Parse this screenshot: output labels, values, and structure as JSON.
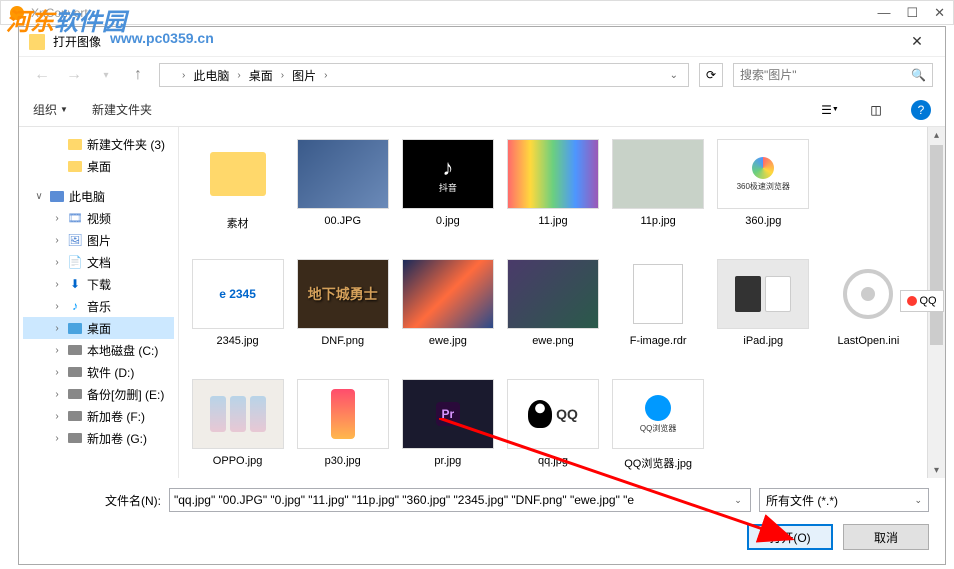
{
  "outerWindow": {
    "title": "XnConvert"
  },
  "watermark": {
    "line1a": "河东",
    "line1b": "软件园",
    "url": "www.pc0359.cn"
  },
  "dialog": {
    "title": "打开图像",
    "breadcrumb": [
      "此电脑",
      "桌面",
      "图片"
    ],
    "searchPlaceholder": "搜索\"图片\"",
    "organize": "组织",
    "newFolder": "新建文件夹"
  },
  "tree": {
    "items": [
      {
        "label": "新建文件夹 (3)",
        "indent": 28,
        "icon": "folder"
      },
      {
        "label": "桌面",
        "indent": 28,
        "icon": "folder"
      },
      {
        "label": "",
        "indent": 0,
        "icon": ""
      },
      {
        "label": "此电脑",
        "indent": 10,
        "icon": "pc",
        "twisty": "∨"
      },
      {
        "label": "视频",
        "indent": 28,
        "icon": "video",
        "twisty": "›"
      },
      {
        "label": "图片",
        "indent": 28,
        "icon": "pic",
        "twisty": "›"
      },
      {
        "label": "文档",
        "indent": 28,
        "icon": "doc",
        "twisty": "›"
      },
      {
        "label": "下载",
        "indent": 28,
        "icon": "down",
        "twisty": "›"
      },
      {
        "label": "音乐",
        "indent": 28,
        "icon": "music",
        "twisty": "›"
      },
      {
        "label": "桌面",
        "indent": 28,
        "icon": "desktop",
        "twisty": "›",
        "selected": true
      },
      {
        "label": "本地磁盘 (C:)",
        "indent": 28,
        "icon": "drive",
        "twisty": "›"
      },
      {
        "label": "软件 (D:)",
        "indent": 28,
        "icon": "drive",
        "twisty": "›"
      },
      {
        "label": "备份[勿删] (E:)",
        "indent": 28,
        "icon": "drive",
        "twisty": "›"
      },
      {
        "label": "新加卷 (F:)",
        "indent": 28,
        "icon": "drive",
        "twisty": "›"
      },
      {
        "label": "新加卷 (G:)",
        "indent": 28,
        "icon": "drive",
        "twisty": "›"
      }
    ]
  },
  "files": [
    {
      "name": "素材",
      "type": "folder"
    },
    {
      "name": "00.JPG",
      "type": "img",
      "cls": "t-00"
    },
    {
      "name": "0.jpg",
      "type": "img",
      "cls": "t-0",
      "sub": "抖音"
    },
    {
      "name": "11.jpg",
      "type": "img",
      "cls": "t-11"
    },
    {
      "name": "11p.jpg",
      "type": "img",
      "cls": "t-11p"
    },
    {
      "name": "360.jpg",
      "type": "img",
      "cls": "t-360",
      "txt": "360极速浏览器"
    },
    {
      "name": "2345.jpg",
      "type": "img",
      "cls": "t-2345",
      "txt": "e 2345"
    },
    {
      "name": "DNF.png",
      "type": "img",
      "cls": "t-dnf",
      "txt": "地下城勇士"
    },
    {
      "name": "ewe.jpg",
      "type": "img",
      "cls": "t-ewe"
    },
    {
      "name": "ewe.png",
      "type": "img",
      "cls": "t-ewe2"
    },
    {
      "name": "F-image.rdr",
      "type": "blank"
    },
    {
      "name": "iPad.jpg",
      "type": "img",
      "cls": "t-ipad"
    },
    {
      "name": "LastOpen.ini",
      "type": "ini"
    },
    {
      "name": "OPPO.jpg",
      "type": "img",
      "cls": "t-oppo"
    },
    {
      "name": "p30.jpg",
      "type": "img",
      "cls": "t-p30"
    },
    {
      "name": "pr.jpg",
      "type": "img",
      "cls": "t-pr",
      "txt": "Pr"
    },
    {
      "name": "qq.jpg",
      "type": "img",
      "cls": "t-qq",
      "txt": "QQ"
    },
    {
      "name": "QQ浏览器.jpg",
      "type": "img",
      "cls": "t-qqb",
      "txt": "QQ浏览器"
    }
  ],
  "filenameLabel": "文件名(N):",
  "filenameValue": "\"qq.jpg\" \"00.JPG\" \"0.jpg\" \"11.jpg\" \"11p.jpg\" \"360.jpg\" \"2345.jpg\" \"DNF.png\" \"ewe.jpg\" \"e",
  "filter": "所有文件 (*.*)",
  "openBtn": "打开(O)",
  "cancelBtn": "取消",
  "qqBadge": "QQ"
}
